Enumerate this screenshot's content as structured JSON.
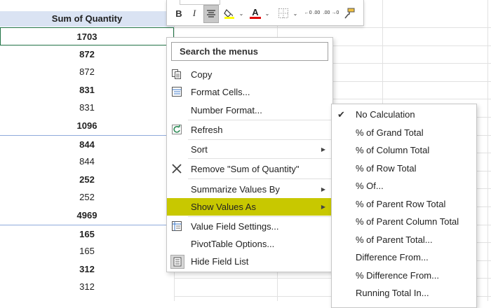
{
  "pivot": {
    "header": "Sum of Quantity",
    "rows": [
      {
        "value": "1703",
        "bold": true,
        "selected": true,
        "sep": false
      },
      {
        "value": "872",
        "bold": true,
        "selected": false,
        "sep": false
      },
      {
        "value": "872",
        "bold": false,
        "selected": false,
        "sep": false
      },
      {
        "value": "831",
        "bold": true,
        "selected": false,
        "sep": false
      },
      {
        "value": "831",
        "bold": false,
        "selected": false,
        "sep": false
      },
      {
        "value": "1096",
        "bold": true,
        "selected": false,
        "sep": false
      },
      {
        "value": "844",
        "bold": true,
        "selected": false,
        "sep": true
      },
      {
        "value": "844",
        "bold": false,
        "selected": false,
        "sep": false
      },
      {
        "value": "252",
        "bold": true,
        "selected": false,
        "sep": false
      },
      {
        "value": "252",
        "bold": false,
        "selected": false,
        "sep": false
      },
      {
        "value": "4969",
        "bold": true,
        "selected": false,
        "sep": false
      },
      {
        "value": "165",
        "bold": true,
        "selected": false,
        "sep": true
      },
      {
        "value": "165",
        "bold": false,
        "selected": false,
        "sep": false
      },
      {
        "value": "312",
        "bold": true,
        "selected": false,
        "sep": false
      },
      {
        "value": "312",
        "bold": false,
        "selected": false,
        "sep": false
      }
    ]
  },
  "mini_toolbar": {
    "bold": "B",
    "italic": "I",
    "font_color_letter": "A",
    "decimal_increase": "←0 .00",
    "decimal_decrease": ".00 →0"
  },
  "context_menu": {
    "search_placeholder": "Search the menus",
    "items": [
      {
        "label": "Copy",
        "icon": "copy-icon",
        "submenu": false
      },
      {
        "label": "Format Cells...",
        "icon": "format-cells-icon",
        "submenu": false
      },
      {
        "label": "Number Format...",
        "icon": "",
        "submenu": false
      },
      {
        "label": "Refresh",
        "icon": "refresh-icon",
        "submenu": false
      },
      {
        "label": "Sort",
        "icon": "",
        "submenu": true
      },
      {
        "label": "Remove \"Sum of Quantity\"",
        "icon": "remove-x-icon",
        "submenu": false
      },
      {
        "label": "Summarize Values By",
        "icon": "",
        "submenu": true
      },
      {
        "label": "Show Values As",
        "icon": "",
        "submenu": true,
        "highlighted": true
      },
      {
        "label": "Value Field Settings...",
        "icon": "value-field-settings-icon",
        "submenu": false
      },
      {
        "label": "PivotTable Options...",
        "icon": "",
        "submenu": false
      },
      {
        "label": "Hide Field List",
        "icon": "field-list-icon",
        "submenu": false
      }
    ]
  },
  "show_values_submenu": {
    "items": [
      {
        "label": "No Calculation",
        "checked": true
      },
      {
        "label": "% of Grand Total",
        "checked": false
      },
      {
        "label": "% of Column Total",
        "checked": false
      },
      {
        "label": "% of Row Total",
        "checked": false
      },
      {
        "label": "% Of...",
        "checked": false
      },
      {
        "label": "% of Parent Row Total",
        "checked": false
      },
      {
        "label": "% of Parent Column Total",
        "checked": false
      },
      {
        "label": "% of Parent Total...",
        "checked": false
      },
      {
        "label": "Difference From...",
        "checked": false
      },
      {
        "label": "% Difference From...",
        "checked": false
      },
      {
        "label": "Running Total In...",
        "checked": false
      }
    ]
  },
  "colors": {
    "header_fill": "#dae3f3",
    "selected_border": "#217346",
    "menu_highlight": "#c8c800",
    "fill_yellow": "#ffff00",
    "font_red": "#e00000"
  }
}
